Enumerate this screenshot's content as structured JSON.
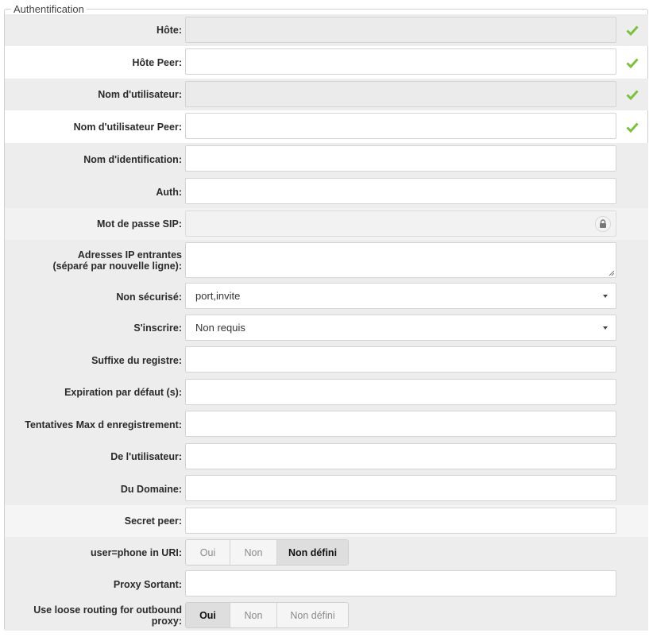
{
  "legend": "Authentification",
  "fields": {
    "hote": {
      "label": "Hôte:",
      "value": ""
    },
    "hote_peer": {
      "label": "Hôte Peer:",
      "value": ""
    },
    "nom_utilisateur": {
      "label": "Nom d'utilisateur:",
      "value": ""
    },
    "nom_utilisateur_peer": {
      "label": "Nom d'utilisateur Peer:",
      "value": ""
    },
    "nom_identification": {
      "label": "Nom d'identification:",
      "value": ""
    },
    "auth": {
      "label": "Auth:",
      "value": ""
    },
    "mot_de_passe": {
      "label": "Mot de passe SIP:",
      "value": ""
    },
    "adresses_ip": {
      "label_line1": "Adresses IP entrantes",
      "label_line2": "(séparé par nouvelle ligne):",
      "value": ""
    },
    "non_securise": {
      "label": "Non sécurisé:",
      "value": "port,invite"
    },
    "sinscrire": {
      "label": "S'inscrire:",
      "value": "Non requis"
    },
    "suffixe": {
      "label": "Suffixe du registre:",
      "value": ""
    },
    "expiration": {
      "label": "Expiration par défaut (s):",
      "value": ""
    },
    "tentatives": {
      "label": "Tentatives Max d enregistrement:",
      "value": ""
    },
    "de_utilisateur": {
      "label": "De l'utilisateur:",
      "value": ""
    },
    "du_domaine": {
      "label": "Du Domaine:",
      "value": ""
    },
    "secret_peer": {
      "label": "Secret peer:",
      "value": ""
    },
    "user_phone": {
      "label": "user=phone in URI:",
      "options": [
        "Oui",
        "Non",
        "Non défini"
      ],
      "selected": "Non défini"
    },
    "proxy_sortant": {
      "label": "Proxy Sortant:",
      "value": ""
    },
    "loose_routing": {
      "label": "Use loose routing for outbound proxy:",
      "options": [
        "Oui",
        "Non",
        "Non défini"
      ],
      "selected": "Oui"
    }
  },
  "colors": {
    "check": "#7cc13e",
    "row_shade": "#ededed"
  },
  "icons": {
    "valid": "checkmark-icon",
    "lock": "lock-icon",
    "dropdown": "caret-down-icon"
  }
}
